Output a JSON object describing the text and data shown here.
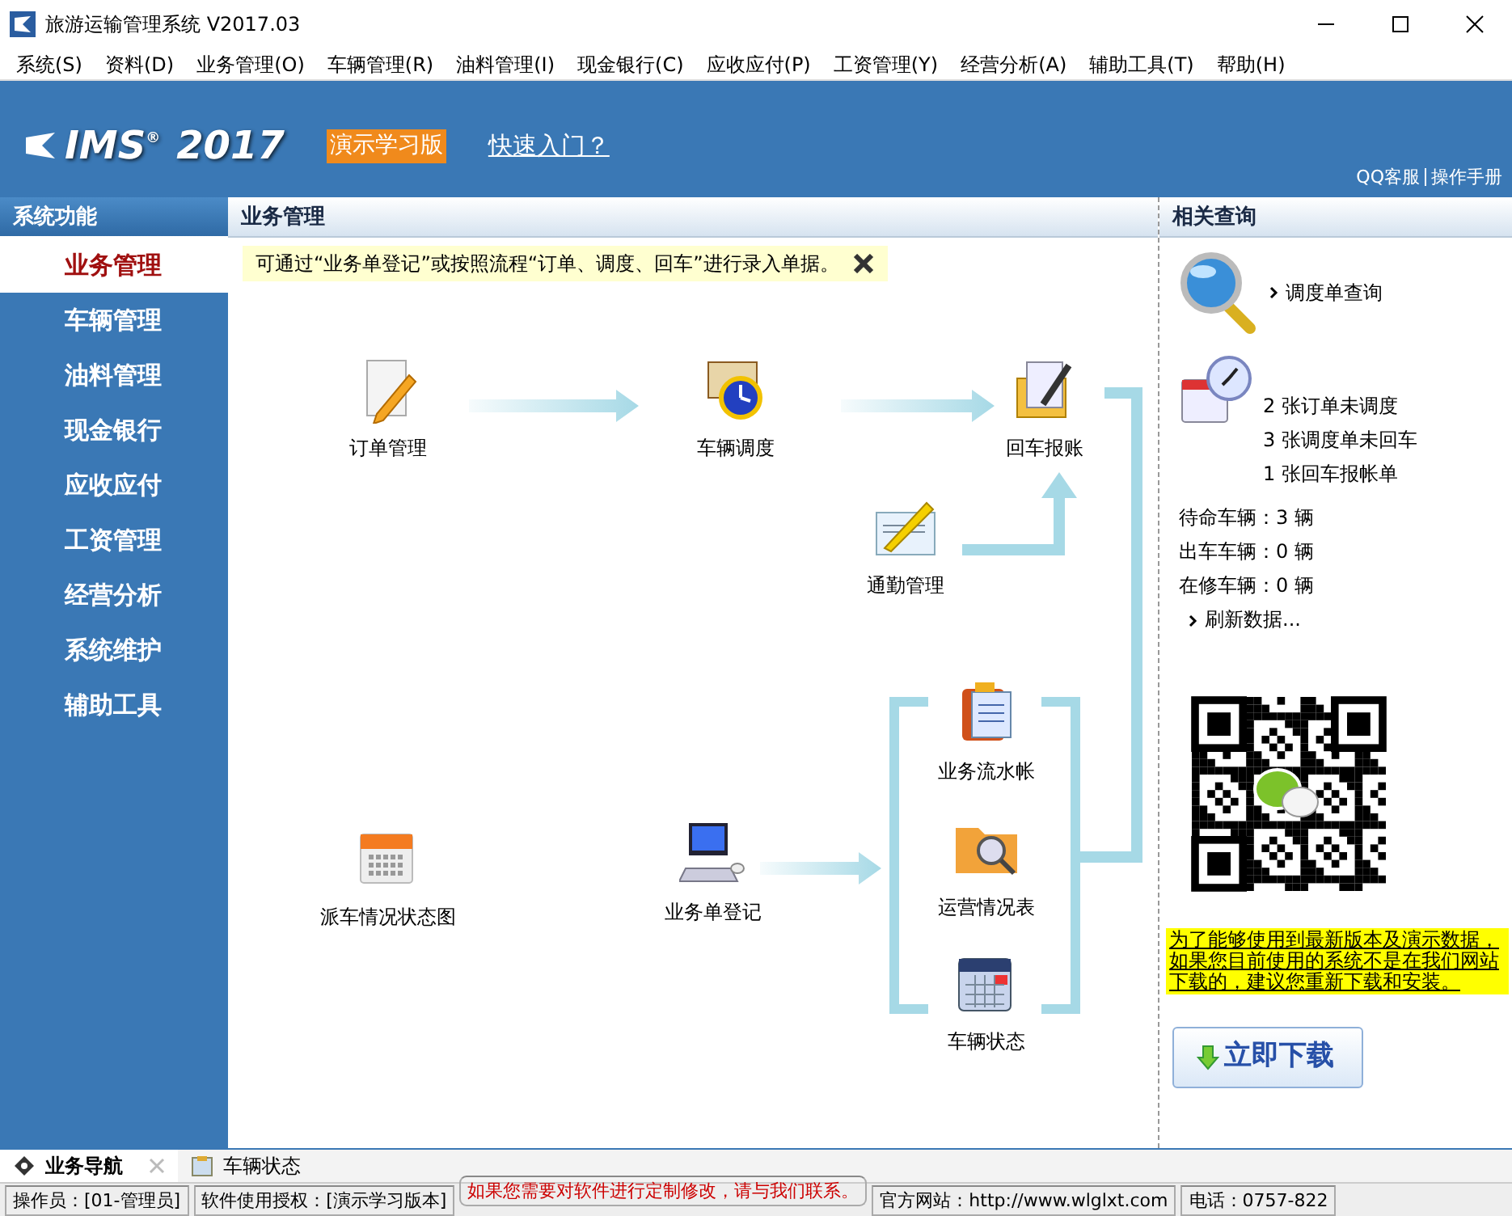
{
  "window": {
    "title": "旅游运输管理系统 V2017.03"
  },
  "menu": [
    "系统(S)",
    "资料(D)",
    "业务管理(O)",
    "车辆管理(R)",
    "油料管理(I)",
    "现金银行(C)",
    "应收应付(P)",
    "工资管理(Y)",
    "经营分析(A)",
    "辅助工具(T)",
    "帮助(H)"
  ],
  "banner": {
    "logo": "IMS",
    "logo_mark": "®",
    "logo_year": "2017",
    "edition": "演示学习版",
    "quick_start": "快速入门？",
    "links": [
      "QQ客服",
      "操作手册"
    ]
  },
  "sidebar": {
    "title": "系统功能",
    "items": [
      {
        "label": "业务管理",
        "selected": true
      },
      {
        "label": "车辆管理",
        "selected": false
      },
      {
        "label": "油料管理",
        "selected": false
      },
      {
        "label": "现金银行",
        "selected": false
      },
      {
        "label": "应收应付",
        "selected": false
      },
      {
        "label": "工资管理",
        "selected": false
      },
      {
        "label": "经营分析",
        "selected": false
      },
      {
        "label": "系统维护",
        "selected": false
      },
      {
        "label": "辅助工具",
        "selected": false
      }
    ]
  },
  "workspace": {
    "title": "业务管理",
    "notice": "可通过“业务单登记”或按照流程“订单、调度、回车”进行录入单据。",
    "nodes": [
      {
        "label": "订单管理",
        "kind": "order"
      },
      {
        "label": "车辆调度",
        "kind": "dispatch"
      },
      {
        "label": "回车报账",
        "kind": "report"
      },
      {
        "label": "通勤管理",
        "kind": "commute"
      },
      {
        "label": "业务流水帐",
        "kind": "ledger"
      },
      {
        "label": "运营情况表",
        "kind": "folder"
      },
      {
        "label": "车辆状态",
        "kind": "calendar"
      },
      {
        "label": "派车情况状态图",
        "kind": "schedule"
      },
      {
        "label": "业务单登记",
        "kind": "computer"
      }
    ]
  },
  "related": {
    "title": "相关查询",
    "query_link": "调度单查询",
    "pending": [
      "2 张订单未调度",
      "3 张调度单未回车",
      "1 张回车报帐单"
    ],
    "vehicles": [
      "待命车辆：3 辆",
      "出车车辆：0 辆",
      "在修车辆：0 辆"
    ],
    "refresh_link": "刷新数据...",
    "update_notice": "为了能够使用到最新版本及演示数据，如果您目前使用的系统不是在我们网站下载的，建议您重新下载和安装。",
    "download_button": "立即下载"
  },
  "tabs": [
    {
      "label": "业务导航",
      "selected": true
    },
    {
      "label": "车辆状态",
      "selected": false
    }
  ],
  "status_bar": [
    {
      "text": "操作员：[01-管理员]",
      "kind": "plain"
    },
    {
      "text": "软件使用授权：[演示学习版本]",
      "kind": "plain"
    },
    {
      "text": "如果您需要对软件进行定制修改，请与我们联系。",
      "kind": "alert"
    },
    {
      "text": "官方网站：http://www.wlglxt.com",
      "kind": "plain"
    },
    {
      "text": "电话：0757-822",
      "kind": "plain"
    }
  ]
}
